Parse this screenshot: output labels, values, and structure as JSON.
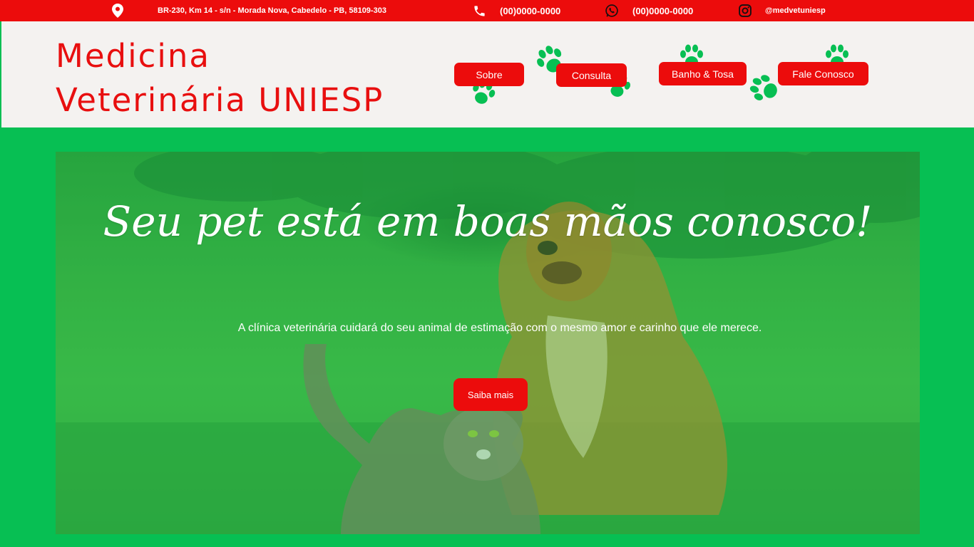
{
  "topbar": {
    "address": "BR-230, Km 14 - s/n - Morada Nova, Cabedelo - PB, 58109-303",
    "phone": "(00)0000-0000",
    "whatsapp": "(00)0000-0000",
    "instagram": "@medvetuniesp",
    "icons": [
      "location-pin-icon",
      "phone-icon",
      "whatsapp-icon",
      "instagram-icon"
    ]
  },
  "header": {
    "brand_line1": "Medicina",
    "brand_line2": "Veterinária UNIESP",
    "nav": {
      "sobre": "Sobre",
      "consulta": "Consulta",
      "banho_tosa": "Banho & Tosa",
      "fale_conosco": "Fale Conosco"
    }
  },
  "hero": {
    "title": "Seu pet está em boas mãos conosco!",
    "subtitle": "A clínica veterinária cuidará do seu animal de estimação com o mesmo amor e carinho que ele merece.",
    "cta_label": "Saiba mais"
  },
  "colors": {
    "brand_red": "#ec0c0c",
    "brand_green": "#07bf53",
    "header_bg": "#f4f2f0"
  }
}
